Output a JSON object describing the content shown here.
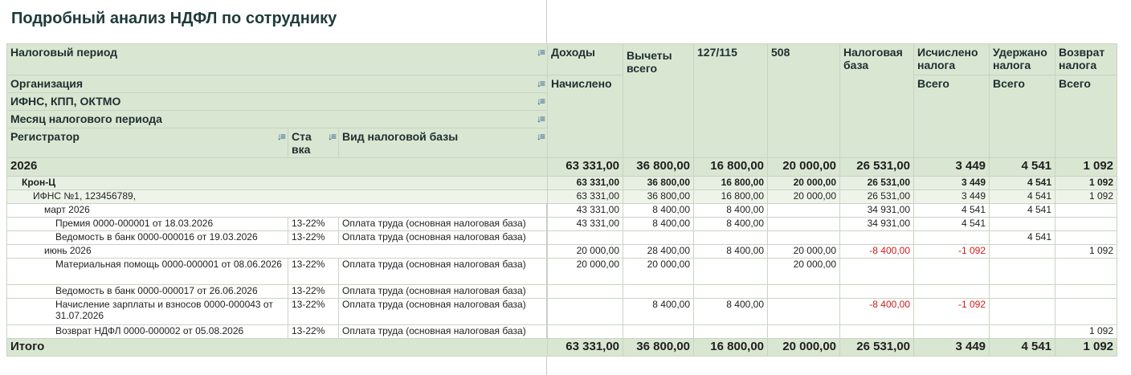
{
  "title": "Подробный анализ НДФЛ по сотруднику",
  "header": {
    "period": "Налоговый период",
    "org": "Организация",
    "ifns": "ИФНС, КПП, ОКТМО",
    "month": "Месяц налогового периода",
    "registrar": "Регистратор",
    "rate_l1": "Ста",
    "rate_l2": "вка",
    "base_kind": "Вид налоговой базы",
    "income": "Доходы",
    "accrued": "Начислено",
    "deductions": "Вычеты всего",
    "c127": "127/115",
    "c508": "508",
    "tax_base": "Налоговая база",
    "calc": "Исчислено налога",
    "calc_total": "Всего",
    "withheld": "Удержано налога",
    "withheld_total": "Всего",
    "refund": "Возврат налога",
    "refund_total": "Всего"
  },
  "rows": {
    "year": {
      "label": "2026",
      "inc": "63 331,00",
      "ded": "36 800,00",
      "c127": "16 800,00",
      "c508": "20 000,00",
      "base": "26 531,00",
      "calc": "3 449",
      "with": "4 541",
      "ref": "1 092"
    },
    "org": {
      "label": "Крон-Ц",
      "inc": "63 331,00",
      "ded": "36 800,00",
      "c127": "16 800,00",
      "c508": "20 000,00",
      "base": "26 531,00",
      "calc": "3 449",
      "with": "4 541",
      "ref": "1 092"
    },
    "ifns": {
      "label": "ИФНС №1, 123456789,",
      "inc": "63 331,00",
      "ded": "36 800,00",
      "c127": "16 800,00",
      "c508": "20 000,00",
      "base": "26 531,00",
      "calc": "3 449",
      "with": "4 541",
      "ref": "1 092"
    },
    "mar": {
      "label": "март 2026",
      "inc": "43 331,00",
      "ded": "8 400,00",
      "c127": "8 400,00",
      "base": "34 931,00",
      "calc": "4 541",
      "with": "4 541"
    },
    "r1": {
      "doc": "Премия 0000-000001 от 18.03.2026",
      "rate": "13-22%",
      "kind": "Оплата труда (основная налоговая база)",
      "inc": "43 331,00",
      "ded": "8 400,00",
      "c127": "8 400,00",
      "base": "34 931,00",
      "calc": "4 541"
    },
    "r2": {
      "doc": "Ведомость в банк 0000-000016 от 19.03.2026",
      "rate": "13-22%",
      "kind": "Оплата труда (основная налоговая база)",
      "with": "4 541"
    },
    "jun": {
      "label": "июнь 2026",
      "inc": "20 000,00",
      "ded": "28 400,00",
      "c127": "8 400,00",
      "c508": "20 000,00",
      "base": "-8 400,00",
      "calc": "-1 092",
      "ref": "1 092"
    },
    "r3": {
      "doc": "Материальная помощь 0000-000001 от 08.06.2026",
      "rate": "13-22%",
      "kind": "Оплата труда (основная налоговая база)",
      "inc": "20 000,00",
      "ded": "20 000,00",
      "c508": "20 000,00"
    },
    "r4": {
      "doc": "Ведомость в банк 0000-000017 от 26.06.2026",
      "rate": "13-22%",
      "kind": "Оплата труда (основная налоговая база)"
    },
    "r5": {
      "doc": "Начисление зарплаты и взносов 0000-000043 от 31.07.2026",
      "rate": "13-22%",
      "kind": "Оплата труда (основная налоговая база)",
      "ded": "8 400,00",
      "c127": "8 400,00",
      "base": "-8 400,00",
      "calc": "-1 092"
    },
    "r6": {
      "doc": "Возврат НДФЛ 0000-000002 от 05.08.2026",
      "rate": "13-22%",
      "kind": "Оплата труда (основная налоговая база)",
      "ref": "1 092"
    },
    "total": {
      "label": "Итого",
      "inc": "63 331,00",
      "ded": "36 800,00",
      "c127": "16 800,00",
      "c508": "20 000,00",
      "base": "26 531,00",
      "calc": "3 449",
      "with": "4 541",
      "ref": "1 092"
    }
  },
  "colors": {
    "header_bg": "#d9e6d2",
    "negative": "#d11a1a",
    "sort_icon": "#2b5a8a"
  }
}
